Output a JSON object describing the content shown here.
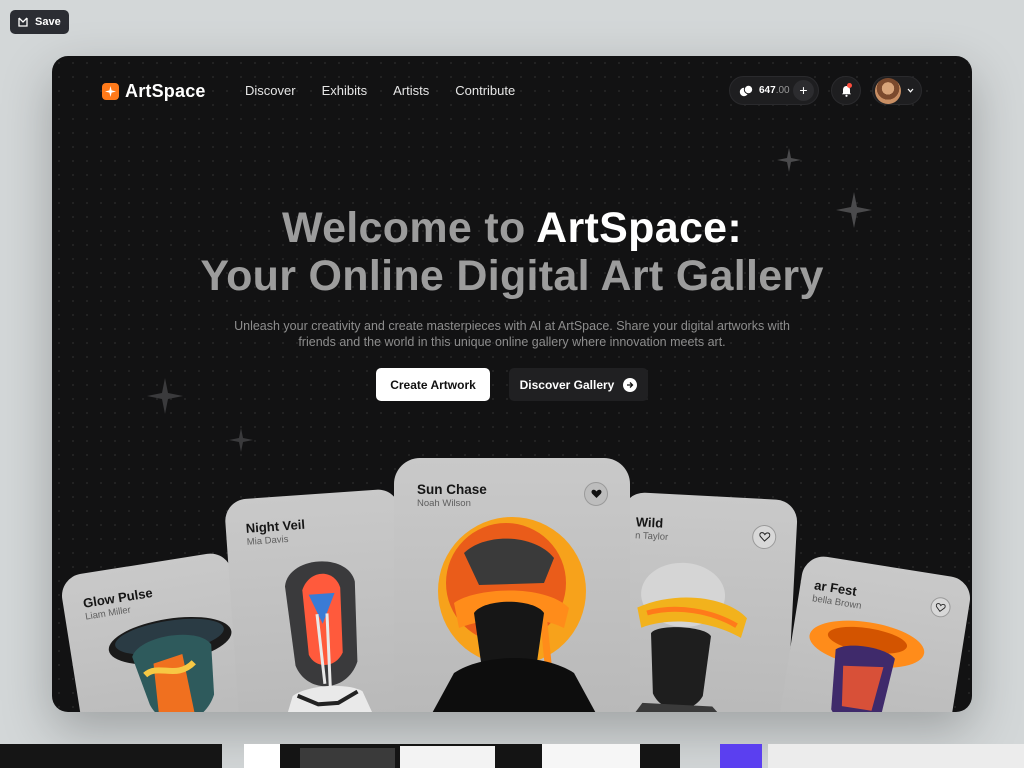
{
  "toolbar": {
    "save_label": "Save"
  },
  "brand": {
    "name": "ArtSpace",
    "accent": "#ff7a1a"
  },
  "nav": [
    "Discover",
    "Exhibits",
    "Artists",
    "Contribute"
  ],
  "wallet": {
    "amount": "647",
    "decimals": ".00",
    "icon": "coins-icon"
  },
  "notifications": {
    "icon": "bell-icon",
    "has_unread": true
  },
  "hero": {
    "title_line1_dim": "Welcome to ",
    "title_line1_bright": "ArtSpace:",
    "title_line2": "Your Online Digital Art Gallery",
    "subtitle": "Unleash your creativity and create masterpieces with AI at ArtSpace. Share your digital artworks with friends and the world in this unique online gallery where innovation meets art.",
    "primary_button": "Create Artwork",
    "secondary_button": "Discover Gallery"
  },
  "cards": [
    {
      "title": "Glow Pulse",
      "artist": "Liam Miller",
      "liked": false
    },
    {
      "title": "Night Veil",
      "artist": "Mia Davis",
      "liked": false
    },
    {
      "title": "Sun Chase",
      "artist": "Noah Wilson",
      "liked": true
    },
    {
      "title": "Wild",
      "artist": "n Taylor",
      "liked": false
    },
    {
      "title": "ar Fest",
      "artist": "bella Brown",
      "liked": false
    }
  ]
}
